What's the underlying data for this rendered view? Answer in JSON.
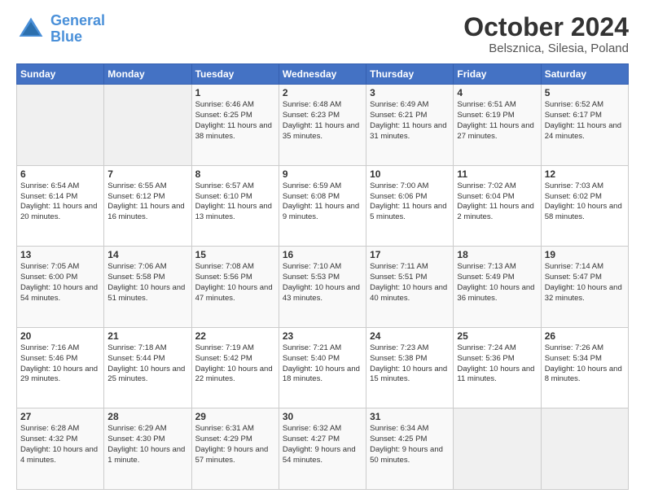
{
  "header": {
    "logo_line1": "General",
    "logo_line2": "Blue",
    "title": "October 2024",
    "subtitle": "Belsznica, Silesia, Poland"
  },
  "days_of_week": [
    "Sunday",
    "Monday",
    "Tuesday",
    "Wednesday",
    "Thursday",
    "Friday",
    "Saturday"
  ],
  "weeks": [
    [
      {
        "day": "",
        "info": ""
      },
      {
        "day": "",
        "info": ""
      },
      {
        "day": "1",
        "info": "Sunrise: 6:46 AM\nSunset: 6:25 PM\nDaylight: 11 hours and 38 minutes."
      },
      {
        "day": "2",
        "info": "Sunrise: 6:48 AM\nSunset: 6:23 PM\nDaylight: 11 hours and 35 minutes."
      },
      {
        "day": "3",
        "info": "Sunrise: 6:49 AM\nSunset: 6:21 PM\nDaylight: 11 hours and 31 minutes."
      },
      {
        "day": "4",
        "info": "Sunrise: 6:51 AM\nSunset: 6:19 PM\nDaylight: 11 hours and 27 minutes."
      },
      {
        "day": "5",
        "info": "Sunrise: 6:52 AM\nSunset: 6:17 PM\nDaylight: 11 hours and 24 minutes."
      }
    ],
    [
      {
        "day": "6",
        "info": "Sunrise: 6:54 AM\nSunset: 6:14 PM\nDaylight: 11 hours and 20 minutes."
      },
      {
        "day": "7",
        "info": "Sunrise: 6:55 AM\nSunset: 6:12 PM\nDaylight: 11 hours and 16 minutes."
      },
      {
        "day": "8",
        "info": "Sunrise: 6:57 AM\nSunset: 6:10 PM\nDaylight: 11 hours and 13 minutes."
      },
      {
        "day": "9",
        "info": "Sunrise: 6:59 AM\nSunset: 6:08 PM\nDaylight: 11 hours and 9 minutes."
      },
      {
        "day": "10",
        "info": "Sunrise: 7:00 AM\nSunset: 6:06 PM\nDaylight: 11 hours and 5 minutes."
      },
      {
        "day": "11",
        "info": "Sunrise: 7:02 AM\nSunset: 6:04 PM\nDaylight: 11 hours and 2 minutes."
      },
      {
        "day": "12",
        "info": "Sunrise: 7:03 AM\nSunset: 6:02 PM\nDaylight: 10 hours and 58 minutes."
      }
    ],
    [
      {
        "day": "13",
        "info": "Sunrise: 7:05 AM\nSunset: 6:00 PM\nDaylight: 10 hours and 54 minutes."
      },
      {
        "day": "14",
        "info": "Sunrise: 7:06 AM\nSunset: 5:58 PM\nDaylight: 10 hours and 51 minutes."
      },
      {
        "day": "15",
        "info": "Sunrise: 7:08 AM\nSunset: 5:56 PM\nDaylight: 10 hours and 47 minutes."
      },
      {
        "day": "16",
        "info": "Sunrise: 7:10 AM\nSunset: 5:53 PM\nDaylight: 10 hours and 43 minutes."
      },
      {
        "day": "17",
        "info": "Sunrise: 7:11 AM\nSunset: 5:51 PM\nDaylight: 10 hours and 40 minutes."
      },
      {
        "day": "18",
        "info": "Sunrise: 7:13 AM\nSunset: 5:49 PM\nDaylight: 10 hours and 36 minutes."
      },
      {
        "day": "19",
        "info": "Sunrise: 7:14 AM\nSunset: 5:47 PM\nDaylight: 10 hours and 32 minutes."
      }
    ],
    [
      {
        "day": "20",
        "info": "Sunrise: 7:16 AM\nSunset: 5:46 PM\nDaylight: 10 hours and 29 minutes."
      },
      {
        "day": "21",
        "info": "Sunrise: 7:18 AM\nSunset: 5:44 PM\nDaylight: 10 hours and 25 minutes."
      },
      {
        "day": "22",
        "info": "Sunrise: 7:19 AM\nSunset: 5:42 PM\nDaylight: 10 hours and 22 minutes."
      },
      {
        "day": "23",
        "info": "Sunrise: 7:21 AM\nSunset: 5:40 PM\nDaylight: 10 hours and 18 minutes."
      },
      {
        "day": "24",
        "info": "Sunrise: 7:23 AM\nSunset: 5:38 PM\nDaylight: 10 hours and 15 minutes."
      },
      {
        "day": "25",
        "info": "Sunrise: 7:24 AM\nSunset: 5:36 PM\nDaylight: 10 hours and 11 minutes."
      },
      {
        "day": "26",
        "info": "Sunrise: 7:26 AM\nSunset: 5:34 PM\nDaylight: 10 hours and 8 minutes."
      }
    ],
    [
      {
        "day": "27",
        "info": "Sunrise: 6:28 AM\nSunset: 4:32 PM\nDaylight: 10 hours and 4 minutes."
      },
      {
        "day": "28",
        "info": "Sunrise: 6:29 AM\nSunset: 4:30 PM\nDaylight: 10 hours and 1 minute."
      },
      {
        "day": "29",
        "info": "Sunrise: 6:31 AM\nSunset: 4:29 PM\nDaylight: 9 hours and 57 minutes."
      },
      {
        "day": "30",
        "info": "Sunrise: 6:32 AM\nSunset: 4:27 PM\nDaylight: 9 hours and 54 minutes."
      },
      {
        "day": "31",
        "info": "Sunrise: 6:34 AM\nSunset: 4:25 PM\nDaylight: 9 hours and 50 minutes."
      },
      {
        "day": "",
        "info": ""
      },
      {
        "day": "",
        "info": ""
      }
    ]
  ]
}
